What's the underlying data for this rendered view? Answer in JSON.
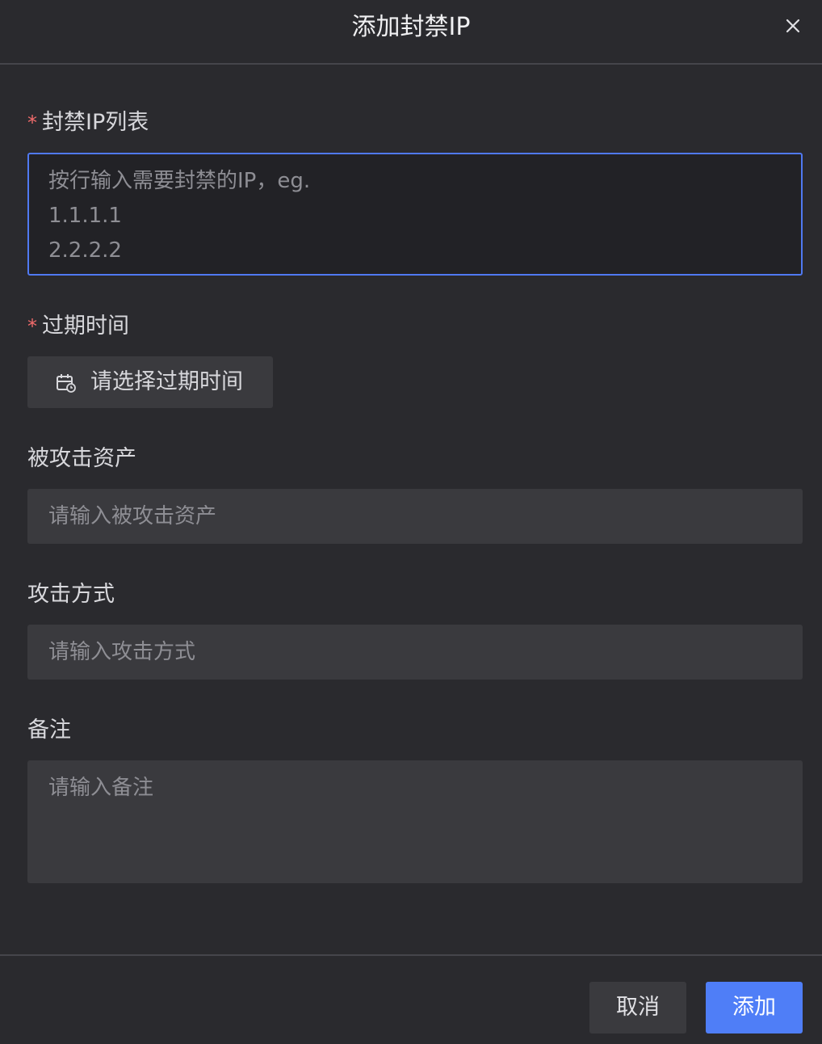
{
  "dialog": {
    "title": "添加封禁IP",
    "close_icon": "close-icon"
  },
  "form": {
    "ip_list": {
      "label": "封禁IP列表",
      "required_mark": "*",
      "placeholder": "按行输入需要封禁的IP，eg.\n1.1.1.1\n2.2.2.2",
      "value": ""
    },
    "expire_time": {
      "label": "过期时间",
      "required_mark": "*",
      "placeholder": "请选择过期时间",
      "icon": "calendar-clock-icon"
    },
    "target_asset": {
      "label": "被攻击资产",
      "placeholder": "请输入被攻击资产",
      "value": ""
    },
    "attack_method": {
      "label": "攻击方式",
      "placeholder": "请输入攻击方式",
      "value": ""
    },
    "note": {
      "label": "备注",
      "placeholder": "请输入备注",
      "value": ""
    }
  },
  "footer": {
    "cancel_label": "取消",
    "submit_label": "添加"
  },
  "colors": {
    "background": "#2a2a2e",
    "input_background": "#3a3a3e",
    "focus_border": "#5079f2",
    "primary_button": "#4f7ef7",
    "required_star": "#f26c6c"
  }
}
